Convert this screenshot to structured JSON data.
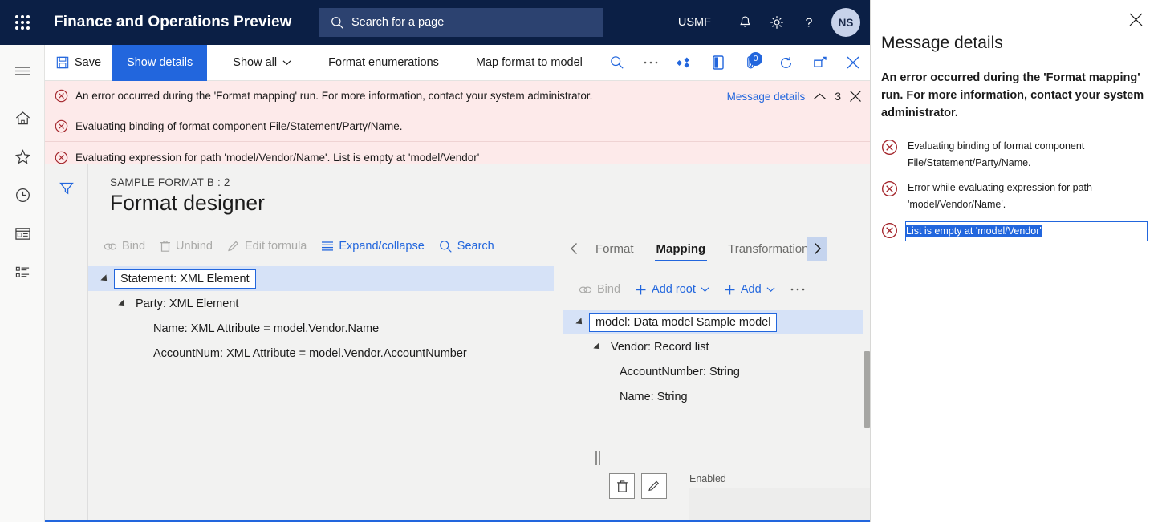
{
  "topbar": {
    "waffle_icon": "app-launcher-icon",
    "title": "Finance and Operations Preview",
    "search": {
      "placeholder": "Search for a page",
      "icon": "search-icon"
    },
    "company": "USMF",
    "notifications_icon": "bell-icon",
    "settings_icon": "gear-icon",
    "help_icon": "question-mark-icon",
    "avatar_initials": "NS"
  },
  "rail": {
    "items": [
      {
        "name": "hamburger-menu",
        "icon": "hamburger-icon"
      },
      {
        "name": "home",
        "icon": "home-icon"
      },
      {
        "name": "favorites",
        "icon": "star-icon"
      },
      {
        "name": "recent",
        "icon": "clock-icon"
      },
      {
        "name": "workspaces",
        "icon": "workspace-icon"
      },
      {
        "name": "modules",
        "icon": "list-icon"
      }
    ]
  },
  "toolbar": {
    "save_label": "Save",
    "save_icon": "save-disk-icon",
    "show_details_label": "Show details",
    "show_all_label": "Show all",
    "format_enumerations_label": "Format enumerations",
    "map_format_to_model_label": "Map format to model",
    "icons": [
      {
        "name": "search-icon"
      },
      {
        "name": "overflow-ellipsis-icon"
      },
      {
        "name": "share-icon"
      },
      {
        "name": "open-in-office-icon"
      },
      {
        "name": "attachments-icon",
        "badge": "0"
      },
      {
        "name": "refresh-icon"
      },
      {
        "name": "popout-icon"
      },
      {
        "name": "close-icon"
      }
    ]
  },
  "messagebar": {
    "rows": [
      {
        "text": "An error occurred during the 'Format mapping' run. For more information, contact your system administrator."
      },
      {
        "text": "Evaluating binding of format component File/Statement/Party/Name."
      },
      {
        "text": "Evaluating expression for path 'model/Vendor/Name'.   List is empty at 'model/Vendor'"
      }
    ],
    "details_link": "Message details",
    "count": "3",
    "collapse_icon": "chevron-up-icon",
    "close_icon": "close-icon"
  },
  "page": {
    "filter_icon": "filter-funnel-icon",
    "breadcrumb": "SAMPLE FORMAT B : 2",
    "title": "Format designer"
  },
  "left_pane": {
    "commands": [
      {
        "label": "Bind",
        "icon": "link-icon",
        "state": "disabled"
      },
      {
        "label": "Unbind",
        "icon": "trash-icon",
        "state": "disabled"
      },
      {
        "label": "Edit formula",
        "icon": "pencil-icon",
        "state": "disabled"
      },
      {
        "label": "Expand/collapse",
        "icon": "list-lines-icon",
        "state": "enabled"
      },
      {
        "label": "Search",
        "icon": "search-icon",
        "state": "enabled"
      }
    ],
    "tree": [
      {
        "label": "Statement: XML Element",
        "indent": 0,
        "twisty": true,
        "selected": true
      },
      {
        "label": "Party: XML Element",
        "indent": 1,
        "twisty": true,
        "selected": false
      },
      {
        "label": "Name: XML Attribute = model.Vendor.Name",
        "indent": 2,
        "twisty": false,
        "selected": false
      },
      {
        "label": "AccountNum: XML Attribute = model.Vendor.AccountNumber",
        "indent": 2,
        "twisty": false,
        "selected": false
      }
    ]
  },
  "right_pane": {
    "tabs": [
      {
        "label": "Format",
        "active": false
      },
      {
        "label": "Mapping",
        "active": true
      },
      {
        "label": "Transformations",
        "active": false,
        "clipped": true
      }
    ],
    "tab_prev_icon": "chevron-left-icon",
    "tab_next_icon": "chevron-right-icon",
    "commands": [
      {
        "label": "Bind",
        "icon": "link-icon",
        "state": "disabled",
        "caret": false
      },
      {
        "label": "Add root",
        "icon": "plus-icon",
        "state": "enabled",
        "caret": true
      },
      {
        "label": "Add",
        "icon": "plus-icon",
        "state": "enabled",
        "caret": true
      },
      {
        "label": "",
        "icon": "overflow-ellipsis-icon",
        "state": "enabled",
        "caret": false
      }
    ],
    "tree": [
      {
        "label": "model: Data model Sample model",
        "indent": 0,
        "twisty": true,
        "selected": true
      },
      {
        "label": "Vendor: Record list",
        "indent": 1,
        "twisty": true,
        "selected": false
      },
      {
        "label": "AccountNumber: String",
        "indent": 2,
        "twisty": false,
        "selected": false
      },
      {
        "label": "Name: String",
        "indent": 2,
        "twisty": false,
        "selected": false
      }
    ],
    "props": {
      "delete_icon": "trash-icon",
      "edit_icon": "pencil-icon",
      "enabled_label": "Enabled",
      "enabled_value": ""
    }
  },
  "sidepanel": {
    "close_icon": "close-icon",
    "title": "Message details",
    "summary": "An error occurred during the 'Format mapping' run. For more information, contact your system administrator.",
    "items": [
      {
        "text": "Evaluating binding of format component File/Statement/Party/Name.",
        "selected": false
      },
      {
        "text": "Error while evaluating expression for path 'model/Vendor/Name'.",
        "selected": false
      },
      {
        "text": "List is empty at 'model/Vendor'",
        "selected": true
      }
    ]
  },
  "colors": {
    "nav_bg": "#0b1f45",
    "accent": "#2266dd",
    "error_bg": "#fdeaea",
    "error_stroke": "#a4262c",
    "workspace_bg": "#f2f2f1",
    "selection_bg": "#d6e2f7"
  }
}
